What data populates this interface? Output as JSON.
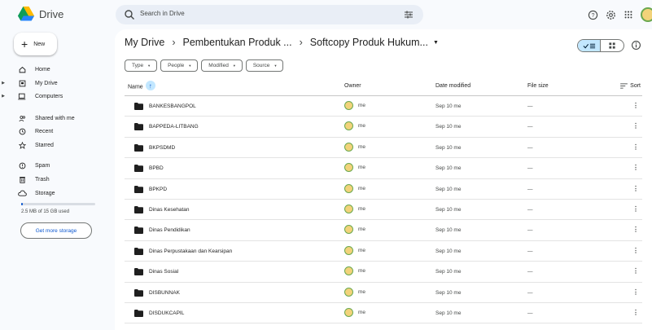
{
  "app": {
    "name": "Drive"
  },
  "search": {
    "placeholder": "Search in Drive"
  },
  "sidebar": {
    "new_label": "New",
    "items": [
      {
        "label": "Home",
        "icon": "home-icon",
        "has_caret": false
      },
      {
        "label": "My Drive",
        "icon": "my-drive-icon",
        "has_caret": true
      },
      {
        "label": "Computers",
        "icon": "computers-icon",
        "has_caret": true
      },
      {
        "label": "Shared with me",
        "icon": "shared-icon",
        "has_caret": false
      },
      {
        "label": "Recent",
        "icon": "clock-icon",
        "has_caret": false
      },
      {
        "label": "Starred",
        "icon": "star-icon",
        "has_caret": false
      },
      {
        "label": "Spam",
        "icon": "spam-icon",
        "has_caret": false
      },
      {
        "label": "Trash",
        "icon": "trash-icon",
        "has_caret": false
      },
      {
        "label": "Storage",
        "icon": "cloud-icon",
        "has_caret": false
      }
    ],
    "storage_text": "2.5 MB of 15 GB used",
    "storage_fraction": 0.02,
    "get_storage_label": "Get more storage"
  },
  "breadcrumb": {
    "items": [
      "My Drive",
      "Pembentukan Produk ...",
      "Softcopy Produk Hukum..."
    ],
    "separator": "›",
    "dropdown": "▼"
  },
  "filters": [
    "Type",
    "People",
    "Modified",
    "Source"
  ],
  "table": {
    "headers": {
      "name": "Name",
      "owner": "Owner",
      "date": "Date modified",
      "size": "File size",
      "sort": "Sort"
    },
    "rows": [
      {
        "name": "BANKESBANGPOL",
        "owner": "me",
        "date": "Sep 10 me",
        "size": "—"
      },
      {
        "name": "BAPPEDA-LITBANG",
        "owner": "me",
        "date": "Sep 10 me",
        "size": "—"
      },
      {
        "name": "BKPSDMD",
        "owner": "me",
        "date": "Sep 10 me",
        "size": "—"
      },
      {
        "name": "BPBD",
        "owner": "me",
        "date": "Sep 10 me",
        "size": "—"
      },
      {
        "name": "BPKPD",
        "owner": "me",
        "date": "Sep 10 me",
        "size": "—"
      },
      {
        "name": "Dinas Kesehatan",
        "owner": "me",
        "date": "Sep 10 me",
        "size": "—"
      },
      {
        "name": "Dinas Pendidikan",
        "owner": "me",
        "date": "Sep 10 me",
        "size": "—"
      },
      {
        "name": "Dinas Perpustakaan dan Kearsipan",
        "owner": "me",
        "date": "Sep 10 me",
        "size": "—"
      },
      {
        "name": "Dinas Sosial",
        "owner": "me",
        "date": "Sep 10 me",
        "size": "—"
      },
      {
        "name": "DISBUNNAK",
        "owner": "me",
        "date": "Sep 10 me",
        "size": "—"
      },
      {
        "name": "DISDUKCAPIL",
        "owner": "me",
        "date": "Sep 10 me",
        "size": "—"
      }
    ]
  },
  "colors": {
    "accent": "#0b57d0",
    "selected": "#c2e7ff",
    "background": "#f8fafd"
  }
}
